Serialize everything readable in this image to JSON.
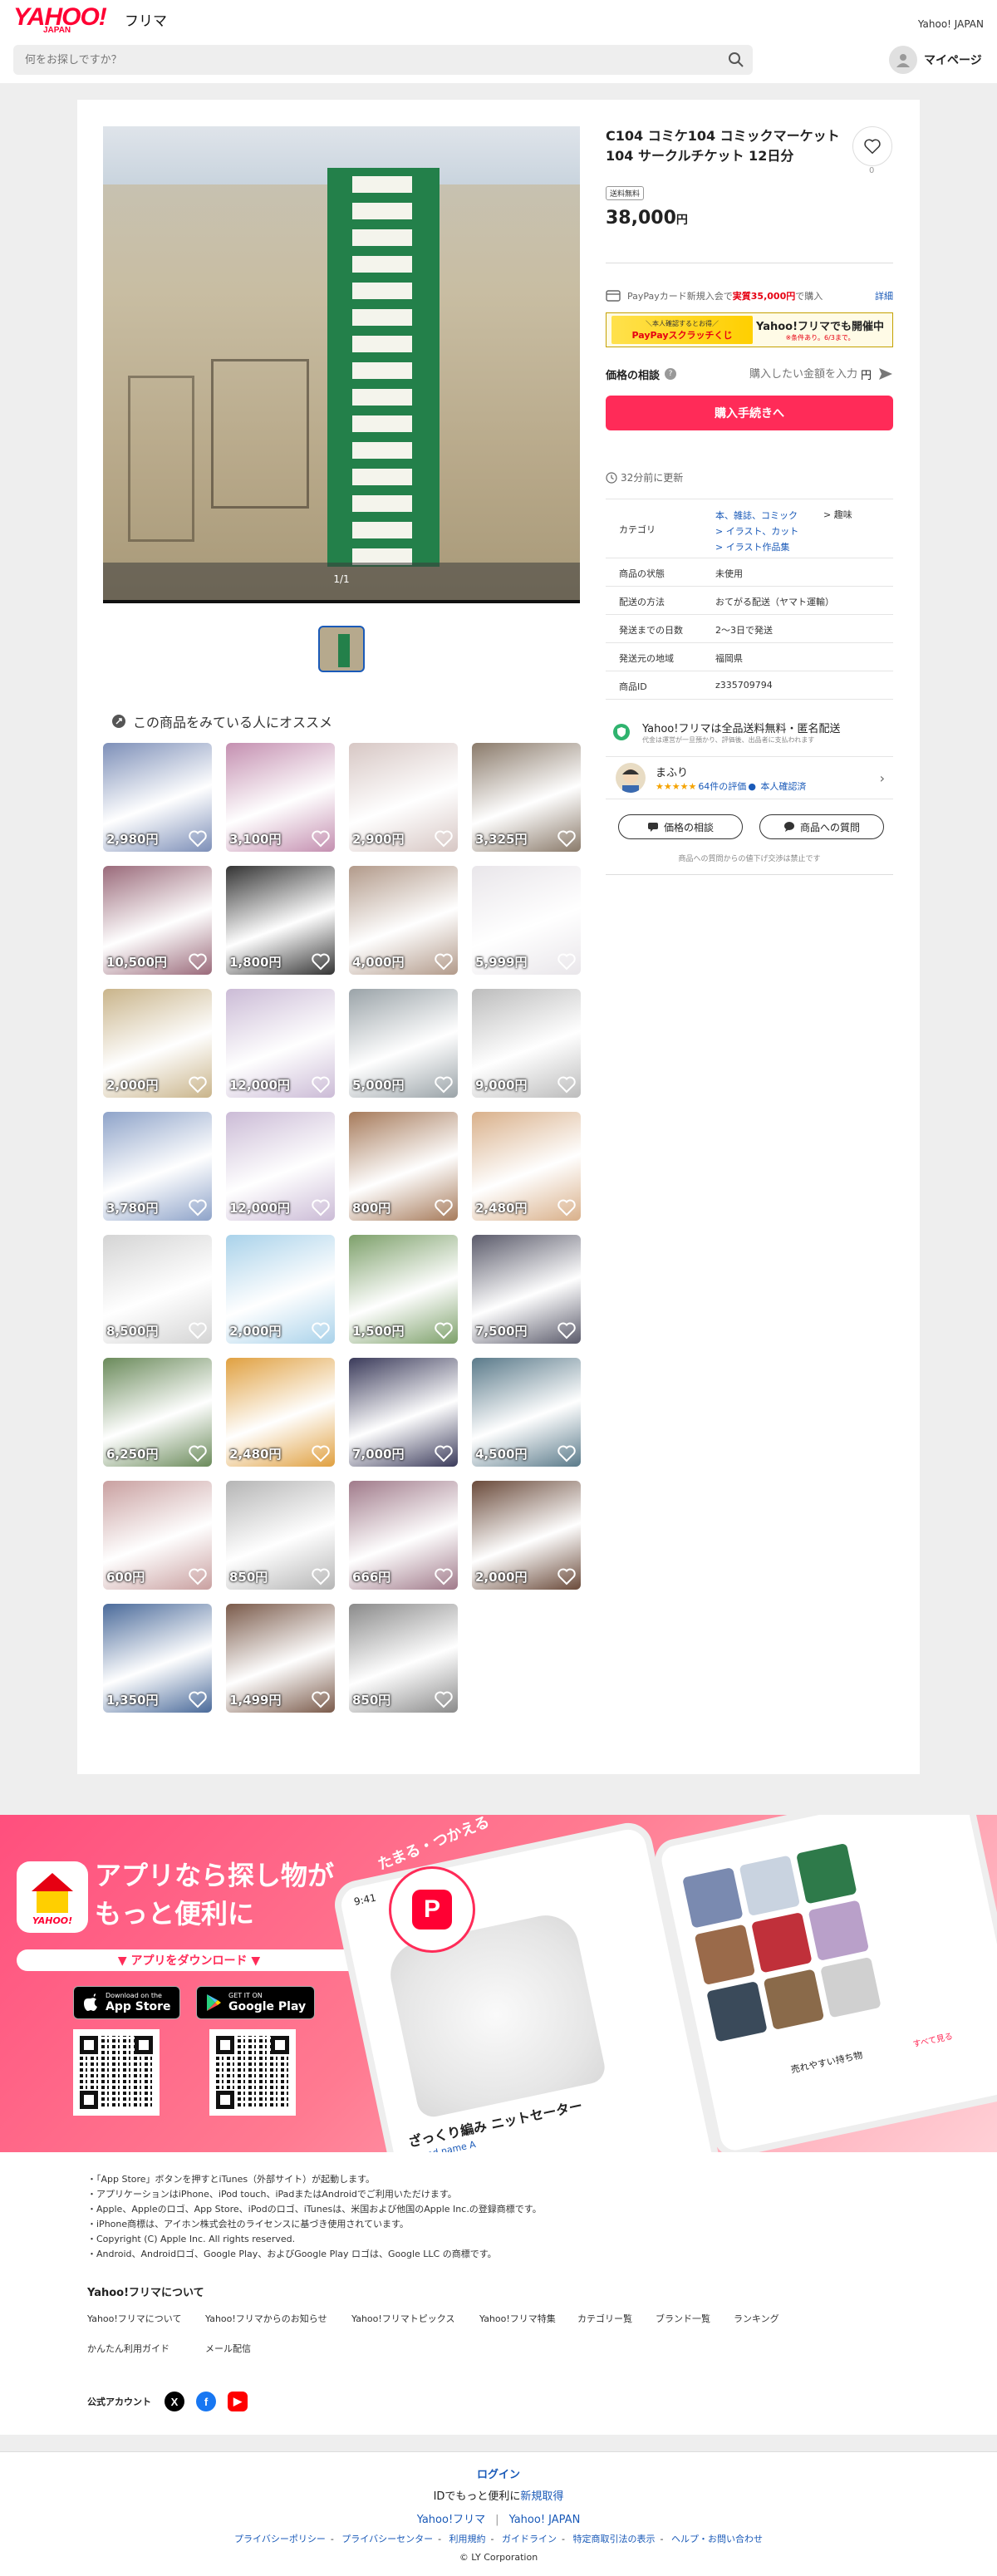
{
  "header": {
    "logo": "YAHOO!",
    "logo_sub": "JAPAN",
    "service": "フリマ",
    "yahoo_japan_link": "Yahoo! JAPAN",
    "search_placeholder": "何をお探しですか？",
    "mypage": "マイページ"
  },
  "gallery": {
    "counter": "1/1"
  },
  "product": {
    "title": "C104 コミケ104 コミックマーケット104 サークルチケット 12日分",
    "favorite_count": "0",
    "shipping_badge": "送料無料",
    "price": "38,000",
    "price_unit": "円",
    "paypay_text_pre": "PayPayカード新規入会で",
    "paypay_text_red": "実質35,000円",
    "paypay_text_post": "で購入",
    "paypay_detail": "詳細",
    "scratch_small": "＼本人確認するとお得／",
    "scratch_big": "PayPayスクラッチくじ",
    "scratch_right_big": "Yahoo!フリマでも開催中",
    "scratch_right_small": "※条件あり。6/3まで。",
    "offer_label": "価格の相談",
    "offer_placeholder": "購入したい金額を入力",
    "offer_yen": "円",
    "buy_button": "購入手続きへ",
    "updated": "32分前に更新"
  },
  "spec": {
    "category_label": "カテゴリ",
    "category_1": "本、雑誌、コミック",
    "category_1b": "趣味",
    "category_2": "イラスト、カット",
    "category_3": "イラスト作品集",
    "condition_label": "商品の状態",
    "condition": "未使用",
    "method_label": "配送の方法",
    "method": "おてがる配送（ヤマト運輸）",
    "days_label": "発送までの日数",
    "days": "2〜3日で発送",
    "origin_label": "発送元の地域",
    "origin": "福岡県",
    "id_label": "商品ID",
    "id": "z335709794"
  },
  "safe": {
    "title": "Yahoo!フリマは全品送料無料・匿名配送",
    "sub": "代金は運営が一旦預かり、評価後、出品者に支払われます"
  },
  "seller": {
    "name": "まふり",
    "stars": "★★★★★",
    "reviews": "64件の評価",
    "verified": "本人確認済"
  },
  "actions": {
    "consult": "価格の相談",
    "question": "商品への質問",
    "ban_note": "商品への質問からの値下げ交渉は禁止です"
  },
  "recommend": {
    "title": "この商品をみている人にオススメ",
    "items": [
      {
        "price": "2,980円",
        "color": "#7d8fb8"
      },
      {
        "price": "3,100円",
        "color": "#c48fb0"
      },
      {
        "price": "2,900円",
        "color": "#d7c7c4"
      },
      {
        "price": "3,325円",
        "color": "#8a7a6a"
      },
      {
        "price": "10,500円",
        "color": "#9a6a7a"
      },
      {
        "price": "1,800円",
        "color": "#333333"
      },
      {
        "price": "4,000円",
        "color": "#b29a8a"
      },
      {
        "price": "5,999円",
        "color": "#e9e6ea"
      },
      {
        "price": "2,000円",
        "color": "#c9b48a"
      },
      {
        "price": "12,000円",
        "color": "#cbbbd6"
      },
      {
        "price": "5,000円",
        "color": "#9aa3a8"
      },
      {
        "price": "9,000円",
        "color": "#bcbcbc"
      },
      {
        "price": "3,780円",
        "color": "#8ea3c9"
      },
      {
        "price": "12,000円",
        "color": "#cbbbd6"
      },
      {
        "price": "800円",
        "color": "#a67a5a"
      },
      {
        "price": "2,480円",
        "color": "#d9b08a"
      },
      {
        "price": "8,500円",
        "color": "#d4d4d4"
      },
      {
        "price": "2,000円",
        "color": "#a9d2ea"
      },
      {
        "price": "1,500円",
        "color": "#7da06a"
      },
      {
        "price": "7,500円",
        "color": "#5a5a6a"
      },
      {
        "price": "6,250円",
        "color": "#6a8a5a"
      },
      {
        "price": "2,480円",
        "color": "#e0a040"
      },
      {
        "price": "7,000円",
        "color": "#3a3a5a"
      },
      {
        "price": "4,500円",
        "color": "#5a7a8a"
      },
      {
        "price": "600円",
        "color": "#c9a0a0"
      },
      {
        "price": "850円",
        "color": "#b5b5b5"
      },
      {
        "price": "666円",
        "color": "#a07a8a"
      },
      {
        "price": "2,000円",
        "color": "#6a4a3a"
      },
      {
        "price": "1,350円",
        "color": "#4a6a9a"
      },
      {
        "price": "1,499円",
        "color": "#7a5a4a"
      },
      {
        "price": "850円",
        "color": "#8a8a8a"
      }
    ]
  },
  "app": {
    "logo_text": "YAHOO!",
    "headline_1": "アプリなら探し物が",
    "headline_2": "もっと便利に",
    "download": "▼ アプリをダウンロード ▼",
    "appstore_small": "Download on the",
    "appstore_big": "App Store",
    "googleplay_small": "GET IT ON",
    "googleplay_big": "Google Play",
    "tamaru": "たまる・つかえる",
    "phone_time": "9:41",
    "phone_title": "ざっくり編み ニットセーター",
    "phone_brand": "Brand name A",
    "phone2_label": "売れやすい持ち物",
    "phone2_more": "すべて見る"
  },
  "notes": [
    "・「App Store」ボタンを押すとiTunes（外部サイト）が起動します。",
    "・アプリケーションはiPhone、iPod touch、iPadまたはAndroidでご利用いただけます。",
    "・Apple、Appleのロゴ、App Store、iPodのロゴ、iTunesは、米国および他国のApple Inc.の登録商標です。",
    "・iPhone商標は、アイホン株式会社のライセンスに基づき使用されています。",
    "・Copyright (C) Apple Inc. All rights reserved.",
    "・Android、Androidロゴ、Google Play、およびGoogle Play ロゴは、Google LLC の商標です。"
  ],
  "about": {
    "title": "Yahoo!フリマについて",
    "links": [
      "Yahoo!フリマについて",
      "Yahoo!フリマからのお知らせ",
      "Yahoo!フリマトピックス",
      "Yahoo!フリマ特集",
      "カテゴリー覧",
      "ブランド一覧",
      "ランキング",
      "かんたん利用ガイド",
      "メール配信"
    ],
    "official": "公式アカウント"
  },
  "footer": {
    "login": "ログイン",
    "more_pre": "IDでもっと便利に",
    "more_link": "新規取得",
    "yf": "Yahoo!フリマ",
    "yj": "Yahoo! JAPAN",
    "legal": [
      "プライバシーポリシー",
      "プライバシーセンター",
      "利用規約",
      "ガイドライン",
      "特定商取引法の表示",
      "ヘルプ・お問い合わせ"
    ],
    "copyright": "© LY Corporation"
  }
}
